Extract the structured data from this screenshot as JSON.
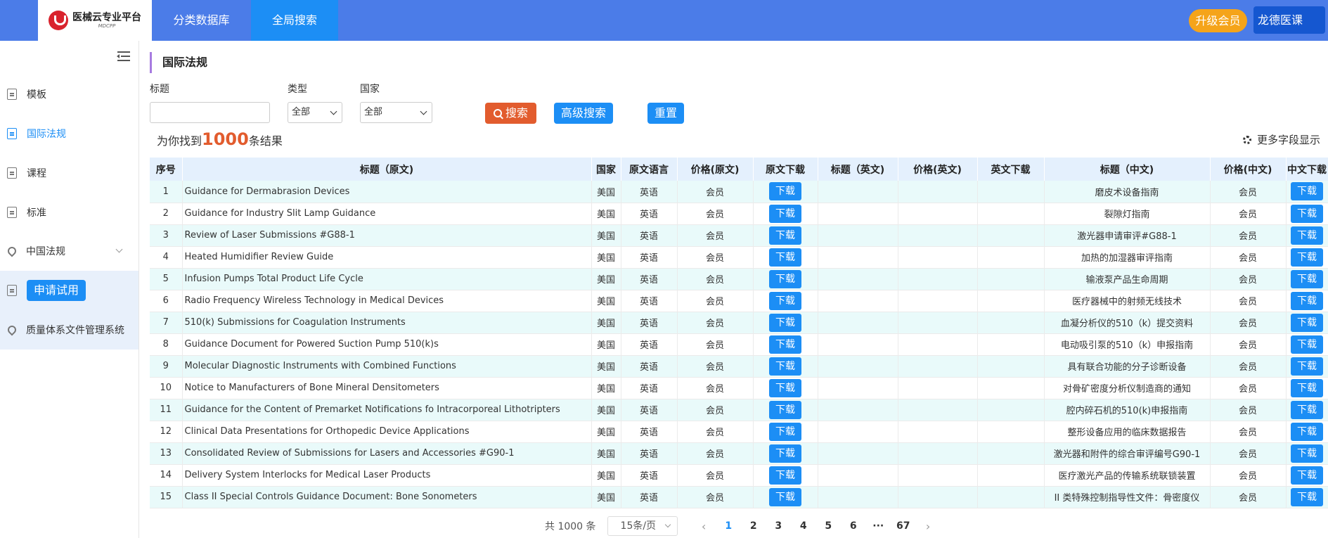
{
  "header": {
    "logo_title": "医械云专业平台",
    "logo_sub": "MDCPP",
    "nav": [
      "分类数据库",
      "全局搜索"
    ],
    "upgrade_label": "升级会员",
    "user_label": "龙德医课"
  },
  "sidebar": {
    "items": [
      {
        "label": "模板",
        "icon": "document-icon"
      },
      {
        "label": "国际法规",
        "icon": "document-icon"
      },
      {
        "label": "课程",
        "icon": "document-icon"
      },
      {
        "label": "标准",
        "icon": "document-icon"
      },
      {
        "label": "中国法规",
        "icon": "location-pin-icon"
      },
      {
        "label": "申请试用",
        "icon": "document-icon"
      },
      {
        "label": "质量体系文件管理系统",
        "icon": "location-pin-icon"
      }
    ]
  },
  "main": {
    "title": "国际法规",
    "filters": {
      "title_label": "标题",
      "title_value": "",
      "type_label": "类型",
      "type_value": "全部",
      "country_label": "国家",
      "country_value": "全部"
    },
    "buttons": {
      "search": "搜索",
      "advanced": "高级搜索",
      "reset": "重置"
    },
    "result_prefix": "为你找到",
    "result_count": "1000",
    "result_suffix": "条结果",
    "more_fields": "更多字段显示"
  },
  "table": {
    "headers": [
      "序号",
      "标题（原文)",
      "国家",
      "原文语言",
      "价格(原文)",
      "原文下载",
      "标题（英文)",
      "价格(英文)",
      "英文下载",
      "标题（中文)",
      "价格(中文)",
      "中文下载"
    ],
    "download_label": "下载",
    "rows": [
      {
        "no": "1",
        "title": "Guidance for Dermabrasion Devices",
        "country": "美国",
        "lang": "英语",
        "price": "会员",
        "title_en": "",
        "price_en": "",
        "title_zh": "磨皮术设备指南",
        "price_zh": "会员"
      },
      {
        "no": "2",
        "title": "Guidance for Industry Slit Lamp Guidance",
        "country": "美国",
        "lang": "英语",
        "price": "会员",
        "title_en": "",
        "price_en": "",
        "title_zh": "裂隙灯指南",
        "price_zh": "会员"
      },
      {
        "no": "3",
        "title": "Review of Laser Submissions #G88-1",
        "country": "美国",
        "lang": "英语",
        "price": "会员",
        "title_en": "",
        "price_en": "",
        "title_zh": "激光器申请审评#G88-1",
        "price_zh": "会员"
      },
      {
        "no": "4",
        "title": "Heated Humidifier Review Guide",
        "country": "美国",
        "lang": "英语",
        "price": "会员",
        "title_en": "",
        "price_en": "",
        "title_zh": "加热的加湿器审评指南",
        "price_zh": "会员"
      },
      {
        "no": "5",
        "title": "Infusion Pumps Total Product Life Cycle",
        "country": "美国",
        "lang": "英语",
        "price": "会员",
        "title_en": "",
        "price_en": "",
        "title_zh": "输液泵产品生命周期",
        "price_zh": "会员"
      },
      {
        "no": "6",
        "title": "Radio Frequency Wireless Technology in Medical Devices",
        "country": "美国",
        "lang": "英语",
        "price": "会员",
        "title_en": "",
        "price_en": "",
        "title_zh": "医疗器械中的射频无线技术",
        "price_zh": "会员"
      },
      {
        "no": "7",
        "title": "510(k) Submissions for Coagulation Instruments",
        "country": "美国",
        "lang": "英语",
        "price": "会员",
        "title_en": "",
        "price_en": "",
        "title_zh": "血凝分析仪的510（k）提交资料",
        "price_zh": "会员"
      },
      {
        "no": "8",
        "title": "Guidance Document for Powered Suction Pump 510(k)s",
        "country": "美国",
        "lang": "英语",
        "price": "会员",
        "title_en": "",
        "price_en": "",
        "title_zh": "电动吸引泵的510（k）申报指南",
        "price_zh": "会员"
      },
      {
        "no": "9",
        "title": "Molecular Diagnostic Instruments with Combined Functions",
        "country": "美国",
        "lang": "英语",
        "price": "会员",
        "title_en": "",
        "price_en": "",
        "title_zh": "具有联合功能的分子诊断设备",
        "price_zh": "会员"
      },
      {
        "no": "10",
        "title": "Notice to Manufacturers of Bone Mineral Densitometers",
        "country": "美国",
        "lang": "英语",
        "price": "会员",
        "title_en": "",
        "price_en": "",
        "title_zh": "对骨矿密度分析仪制造商的通知",
        "price_zh": "会员"
      },
      {
        "no": "11",
        "title": "Guidance for the Content of Premarket Notifications fo Intracorporeal Lithotripters",
        "country": "美国",
        "lang": "英语",
        "price": "会员",
        "title_en": "",
        "price_en": "",
        "title_zh": "腔内碎石机的510(k)申报指南",
        "price_zh": "会员"
      },
      {
        "no": "12",
        "title": "Clinical Data Presentations for Orthopedic Device Applications",
        "country": "美国",
        "lang": "英语",
        "price": "会员",
        "title_en": "",
        "price_en": "",
        "title_zh": "整形设备应用的临床数据报告",
        "price_zh": "会员"
      },
      {
        "no": "13",
        "title": "Consolidated Review of Submissions for Lasers and Accessories #G90-1",
        "country": "美国",
        "lang": "英语",
        "price": "会员",
        "title_en": "",
        "price_en": "",
        "title_zh": "激光器和附件的综合审评编号G90-1",
        "price_zh": "会员"
      },
      {
        "no": "14",
        "title": "Delivery System Interlocks for Medical Laser Products",
        "country": "美国",
        "lang": "英语",
        "price": "会员",
        "title_en": "",
        "price_en": "",
        "title_zh": "医疗激光产品的传输系统联锁装置",
        "price_zh": "会员"
      },
      {
        "no": "15",
        "title": "Class II Special Controls Guidance Document: Bone Sonometers",
        "country": "美国",
        "lang": "英语",
        "price": "会员",
        "title_en": "",
        "price_en": "",
        "title_zh": "II 类特殊控制指导性文件：骨密度仪",
        "price_zh": "会员"
      }
    ]
  },
  "pagination": {
    "total": "共 1000 条",
    "page_size": "15条/页",
    "pages": [
      "1",
      "2",
      "3",
      "4",
      "5",
      "6",
      "···",
      "67"
    ],
    "current": "1",
    "prev_icon": "chevron-left-icon",
    "next_icon": "chevron-right-icon"
  },
  "colors": {
    "topbar": "#4b7ce8",
    "accent": "#1c8ef5",
    "search_button": "#e25c2e",
    "upgrade": "#f5a41a"
  }
}
